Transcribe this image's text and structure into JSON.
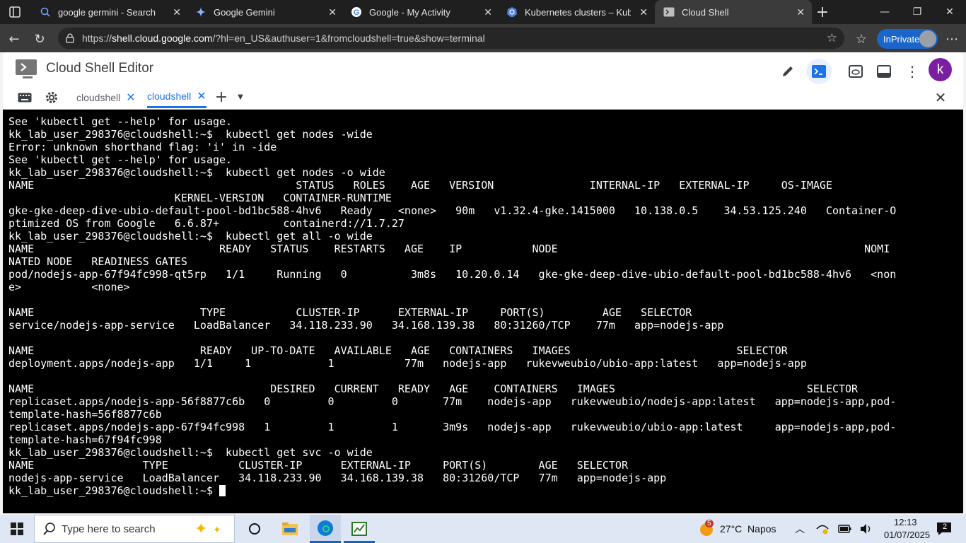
{
  "browser": {
    "tabs": [
      {
        "title": "google germini - Search",
        "icon": "search-icon"
      },
      {
        "title": "Google Gemini",
        "icon": "gemini-icon"
      },
      {
        "title": "Google - My Activity",
        "icon": "google-icon"
      },
      {
        "title": "Kubernetes clusters – Kuberne",
        "icon": "kubernetes-icon"
      },
      {
        "title": "Cloud Shell",
        "icon": "cloud-shell-icon"
      }
    ],
    "url_prefix": "https://",
    "url_host": "shell.cloud.google.com",
    "url_rest": "/?hl=en_US&authuser=1&fromcloudshell=true&show=terminal",
    "inprivate_label": "InPrivate"
  },
  "app": {
    "title": "Cloud Shell Editor",
    "avatar_letter": "k",
    "terminal_tabs": [
      {
        "label": "cloudshell",
        "active": false
      },
      {
        "label": "cloudshell",
        "active": true
      }
    ]
  },
  "terminal": {
    "lines": [
      "See 'kubectl get --help' for usage.",
      "kk_lab_user_298376@cloudshell:~$  kubectl get nodes -wide",
      "Error: unknown shorthand flag: 'i' in -ide",
      "See 'kubectl get --help' for usage.",
      "kk_lab_user_298376@cloudshell:~$  kubectl get nodes -o wide",
      "NAME                                         STATUS   ROLES    AGE   VERSION               INTERNAL-IP   EXTERNAL-IP     OS-IMAGE",
      "                          KERNEL-VERSION   CONTAINER-RUNTIME",
      "gke-gke-deep-dive-ubio-default-pool-bd1bc588-4hv6   Ready    <none>   90m   v1.32.4-gke.1415000   10.138.0.5    34.53.125.240   Container-O",
      "ptimized OS from Google   6.6.87+          containerd://1.7.27",
      "kk_lab_user_298376@cloudshell:~$  kubectl get all -o wide",
      "NAME                             READY   STATUS    RESTARTS   AGE    IP           NODE                                                NOMI",
      "NATED NODE   READINESS GATES",
      "pod/nodejs-app-67f94fc998-qt5rp   1/1     Running   0          3m8s   10.20.0.14   gke-gke-deep-dive-ubio-default-pool-bd1bc588-4hv6   <non",
      "e>           <none>",
      "",
      "NAME                          TYPE           CLUSTER-IP      EXTERNAL-IP     PORT(S)         AGE   SELECTOR",
      "service/nodejs-app-service   LoadBalancer   34.118.233.90   34.168.139.38   80:31260/TCP    77m   app=nodejs-app",
      "",
      "NAME                          READY   UP-TO-DATE   AVAILABLE   AGE   CONTAINERS   IMAGES                          SELECTOR",
      "deployment.apps/nodejs-app   1/1     1            1           77m   nodejs-app   rukevweubio/ubio-app:latest   app=nodejs-app",
      "",
      "NAME                                     DESIRED   CURRENT   READY   AGE    CONTAINERS   IMAGES                              SELECTOR",
      "replicaset.apps/nodejs-app-56f8877c6b   0         0         0       77m    nodejs-app   rukevweubio/nodejs-app:latest   app=nodejs-app,pod-",
      "template-hash=56f8877c6b",
      "replicaset.apps/nodejs-app-67f94fc998   1         1         1       3m9s   nodejs-app   rukevweubio/ubio-app:latest     app=nodejs-app,pod-",
      "template-hash=67f94fc998",
      "kk_lab_user_298376@cloudshell:~$  kubectl get svc -o wide",
      "NAME                 TYPE           CLUSTER-IP      EXTERNAL-IP     PORT(S)        AGE   SELECTOR",
      "nodejs-app-service   LoadBalancer   34.118.233.90   34.168.139.38   80:31260/TCP   77m   app=nodejs-app"
    ],
    "prompt": "kk_lab_user_298376@cloudshell:~$ "
  },
  "taskbar": {
    "search_placeholder": "Type here to search",
    "weather": "27°C  Napos",
    "weather_badge": "5",
    "time": "12:13",
    "date": "01/07/2025",
    "notification_count": "2"
  }
}
